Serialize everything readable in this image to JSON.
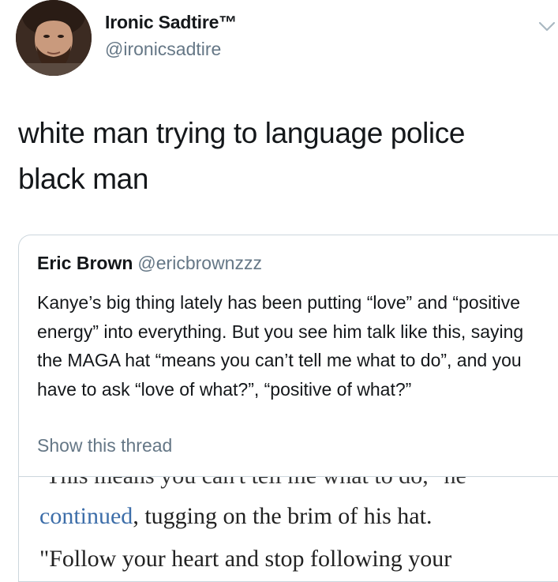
{
  "tweet": {
    "display_name": "Ironic Sadtire™",
    "handle": "@ironicsadtire",
    "text": "white man trying to language police black man",
    "avatar_icon": "user-avatar-photo",
    "menu_icon": "chevron-down-icon"
  },
  "quote": {
    "display_name": "Eric Brown",
    "handle": "@ericbrownzzz",
    "text": "Kanye’s big thing lately has been putting “love” and “positive energy” into everything. But you see him talk like this, saying the MAGA hat “means you can’t tell me what to do”, and you have to ask “love of what?”, “positive of what?”",
    "show_thread_label": "Show this thread",
    "image": {
      "cut_line": "\"This means you can't tell me what to do,\" he",
      "link_word": "continued",
      "line_2_rest": ", tugging on the brim of his hat.",
      "line_3": "\"Follow your heart and stop following your"
    }
  },
  "colors": {
    "text": "#14171a",
    "secondary": "#657786",
    "border": "#ccd6dd",
    "link": "#3d6ea9"
  }
}
